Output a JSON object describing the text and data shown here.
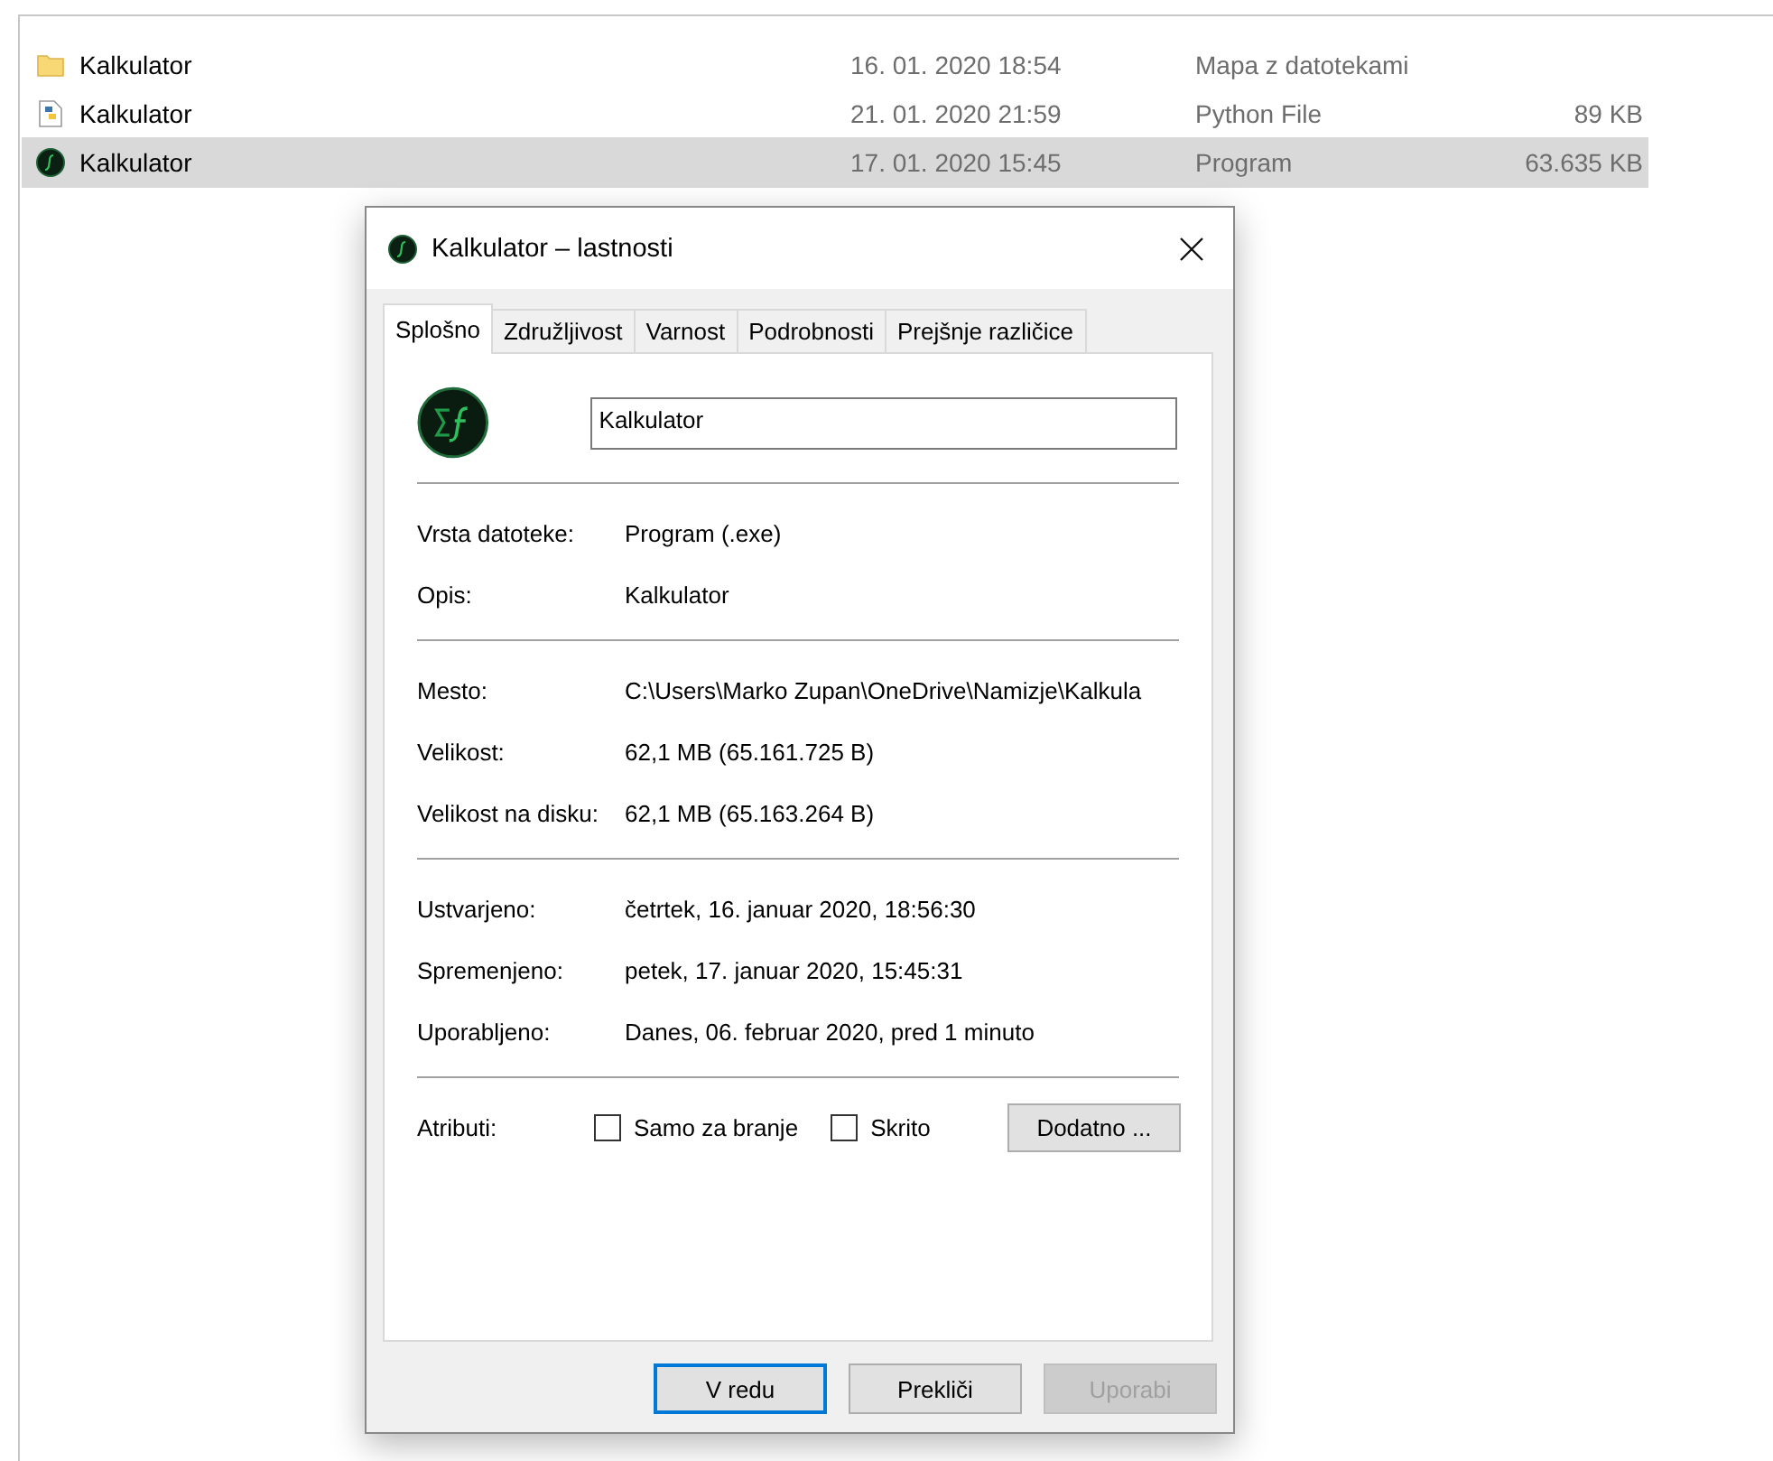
{
  "files": [
    {
      "kind": "folder",
      "name": "Kalkulator",
      "modified": "16. 01. 2020 18:54",
      "type": "Mapa z datotekami",
      "selected": false
    },
    {
      "kind": "python",
      "name": "Kalkulator",
      "modified": "21. 01. 2020 21:59",
      "type": "Python File",
      "size": "89 KB",
      "selected": false
    },
    {
      "kind": "program",
      "name": "Kalkulator",
      "modified": "17. 01. 2020 15:45",
      "type": "Program",
      "size": "63.635 KB",
      "selected": true
    }
  ],
  "dialog": {
    "title": "Kalkulator – lastnosti",
    "tabs": [
      {
        "label": "Splošno",
        "selected": true
      },
      {
        "label": "Združljivost",
        "selected": false
      },
      {
        "label": "Varnost",
        "selected": false
      },
      {
        "label": "Podrobnosti",
        "selected": false
      },
      {
        "label": "Prejšnje različice",
        "selected": false
      }
    ],
    "name_field": {
      "value": "Kalkulator"
    },
    "groups": [
      [
        {
          "label": "Vrsta datoteke:",
          "value": "Program (.exe)"
        },
        {
          "label": "Opis:",
          "value": "Kalkulator"
        }
      ],
      [
        {
          "label": "Mesto:",
          "value": "C:\\Users\\Marko Zupan\\OneDrive\\Namizje\\Kalkula"
        },
        {
          "label": "Velikost:",
          "value": "62,1 MB (65.161.725 B)"
        },
        {
          "label": "Velikost na disku:",
          "value": "62,1 MB (65.163.264 B)"
        }
      ],
      [
        {
          "label": "Ustvarjeno:",
          "value": "četrtek, 16. januar 2020, 18:56:30"
        },
        {
          "label": "Spremenjeno:",
          "value": "petek, 17. januar 2020, 15:45:31"
        },
        {
          "label": "Uporabljeno:",
          "value": "Danes, 06. februar 2020, pred 1 minuto"
        }
      ]
    ],
    "attributes": {
      "label": "Atributi:",
      "checkboxes": [
        {
          "label": "Samo za branje",
          "checked": false
        },
        {
          "label": "Skrito",
          "checked": false
        }
      ],
      "button": "Dodatno ..."
    },
    "buttons": [
      {
        "label": "V redu",
        "default": true,
        "disabled": false
      },
      {
        "label": "Prekliči",
        "default": false,
        "disabled": false
      },
      {
        "label": "Uporabi",
        "default": false,
        "disabled": true
      }
    ]
  }
}
